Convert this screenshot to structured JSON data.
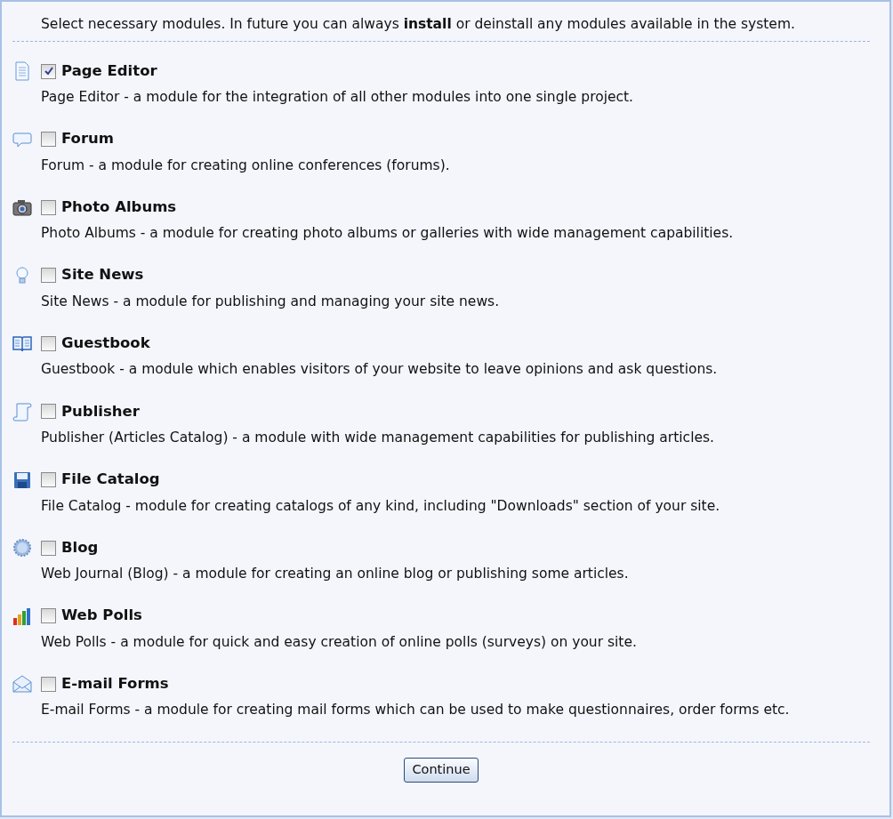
{
  "intro": "Select necessary modules. In future you can always **install** or deinstall any modules available in the system.",
  "modules": [
    {
      "name": "Page Editor",
      "checked": true,
      "description": "Page Editor - a module for the integration of all other modules into one single project."
    },
    {
      "name": "Forum",
      "checked": false,
      "description": "Forum - a module for creating online conferences (forums)."
    },
    {
      "name": "Photo Albums",
      "checked": false,
      "description": "Photo Albums - a module for creating photo albums or galleries with wide management capabilities."
    },
    {
      "name": "Site News",
      "checked": false,
      "description": "Site News - a module for publishing and managing your site news."
    },
    {
      "name": "Guestbook",
      "checked": false,
      "description": "Guestbook - a module which enables visitors of your website to leave opinions and ask questions."
    },
    {
      "name": "Publisher",
      "checked": false,
      "description": "Publisher (Articles Catalog) - a module with wide management capabilities for publishing articles."
    },
    {
      "name": "File Catalog",
      "checked": false,
      "description": "File Catalog - module for creating catalogs of any kind, including \"Downloads\" section of your site."
    },
    {
      "name": "Blog",
      "checked": false,
      "description": "Web Journal (Blog) - a module for creating an online blog or publishing some articles."
    },
    {
      "name": "Web Polls",
      "checked": false,
      "description": "Web Polls - a module for quick and easy creation of online polls (surveys) on your site."
    },
    {
      "name": "E-mail Forms",
      "checked": false,
      "description": "E-mail Forms - a module for creating mail forms which can be used to make questionnaires, order forms etc."
    }
  ],
  "button": "Continue"
}
